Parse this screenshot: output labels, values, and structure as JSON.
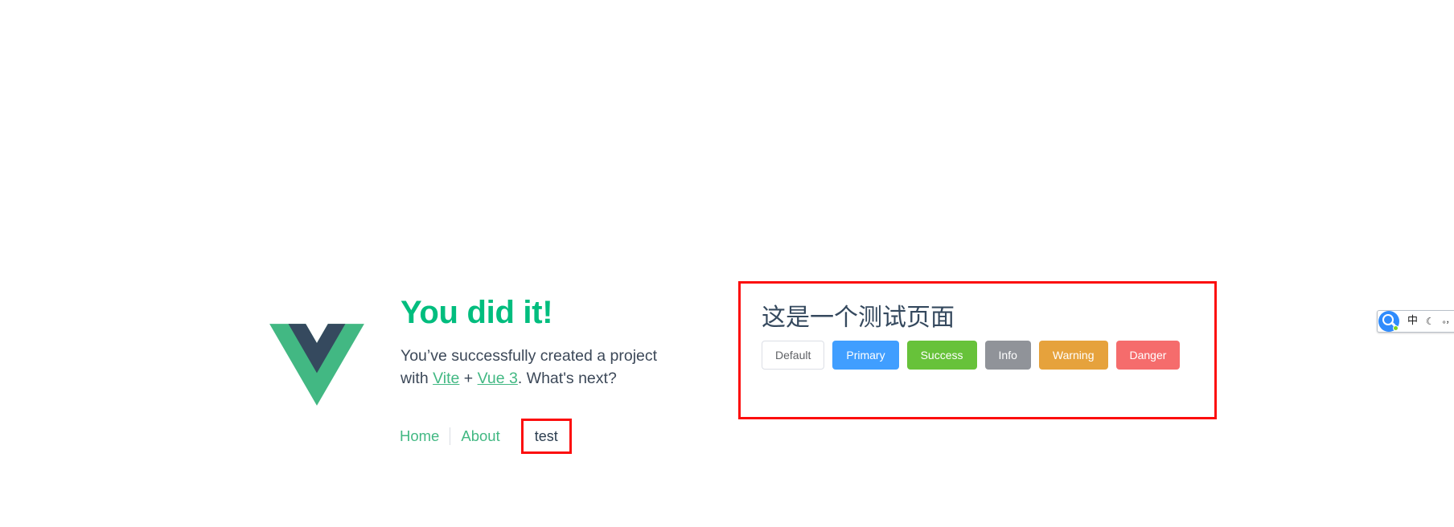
{
  "welcome": {
    "logo_icon": "vue-logo-icon",
    "logo_green": "#42b883",
    "logo_navy": "#35495e",
    "headline": "You did it!",
    "subtext_before": "You’ve successfully created a project with ",
    "link_vite": "Vite",
    "plus": " + ",
    "link_vue": "Vue 3",
    "subtext_after": ". What's next?",
    "headline_color": "#00bd7e"
  },
  "nav": {
    "home": "Home",
    "about": "About",
    "test": "test",
    "link_color": "#42b883",
    "highlight_color": "#fc0d0d"
  },
  "test_panel": {
    "title": "这是一个测试页面",
    "border_color": "#fc0d0d",
    "buttons": [
      {
        "label": "Default",
        "variant": "default",
        "color": "#ffffff"
      },
      {
        "label": "Primary",
        "variant": "primary",
        "color": "#409eff"
      },
      {
        "label": "Success",
        "variant": "success",
        "color": "#67c23a"
      },
      {
        "label": "Info",
        "variant": "info",
        "color": "#909399"
      },
      {
        "label": "Warning",
        "variant": "warning",
        "color": "#e6a23c"
      },
      {
        "label": "Danger",
        "variant": "danger",
        "color": "#f56c6c"
      }
    ]
  },
  "ime_toolbar": {
    "logo_icon": "qq-pinyin-logo-icon",
    "logo_color": "#2f8bfc",
    "mode": "中",
    "moon_icon": "🌙",
    "moon_label": "☾",
    "punctuation": "。，"
  }
}
